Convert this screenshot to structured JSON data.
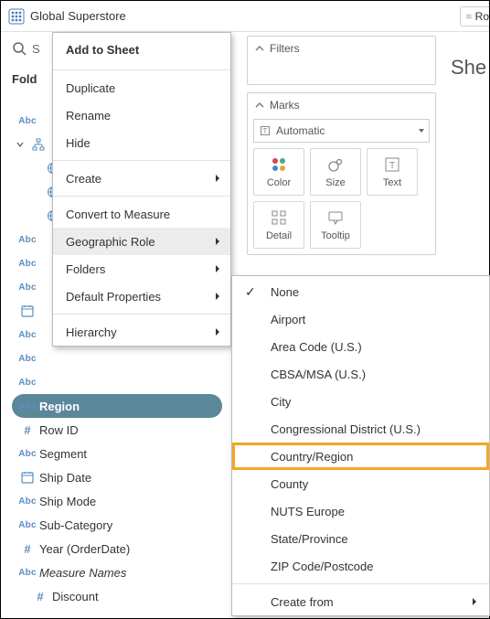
{
  "header": {
    "title": "Global Superstore"
  },
  "search": {
    "placeholder": "S"
  },
  "folders_label": "Fold",
  "sheet_stub": "She",
  "rows_stub": "Ro",
  "filters_card": "Filters",
  "marks_card": "Marks",
  "marks_select": "Automatic",
  "marks_buttons": {
    "color": "Color",
    "size": "Size",
    "text": "Text",
    "detail": "Detail",
    "tooltip": "Tooltip"
  },
  "fields": [
    {
      "icon": "abc",
      "label": "",
      "indent": 0,
      "kind": "abc"
    },
    {
      "icon": "hier",
      "label": "",
      "indent": 0,
      "expanded": true
    },
    {
      "icon": "globe",
      "label": "",
      "indent": 2
    },
    {
      "icon": "globe",
      "label": "",
      "indent": 2
    },
    {
      "icon": "globe",
      "label": "",
      "indent": 2
    },
    {
      "icon": "abc",
      "label": "",
      "indent": 0
    },
    {
      "icon": "abc",
      "label": "",
      "indent": 0
    },
    {
      "icon": "abc",
      "label": "",
      "indent": 0
    },
    {
      "icon": "date",
      "label": "",
      "indent": 0
    },
    {
      "icon": "abc",
      "label": "",
      "indent": 0
    },
    {
      "icon": "abc",
      "label": "",
      "indent": 0
    },
    {
      "icon": "abc",
      "label": "",
      "indent": 0
    },
    {
      "icon": "abc",
      "label": "Region",
      "indent": 0,
      "selected": true
    },
    {
      "icon": "hash",
      "label": "Row ID",
      "indent": 0
    },
    {
      "icon": "abc",
      "label": "Segment",
      "indent": 0
    },
    {
      "icon": "date",
      "label": "Ship Date",
      "indent": 0
    },
    {
      "icon": "abc",
      "label": "Ship Mode",
      "indent": 0
    },
    {
      "icon": "abc",
      "label": "Sub-Category",
      "indent": 0
    },
    {
      "icon": "hash",
      "label": "Year (OrderDate)",
      "indent": 0
    },
    {
      "icon": "abc",
      "label": "Measure Names",
      "indent": 0,
      "italic": true
    },
    {
      "icon": "hash",
      "label": "Discount",
      "indent": 1
    }
  ],
  "context_menu": {
    "header": "Add to Sheet",
    "items": [
      {
        "label": "Duplicate"
      },
      {
        "label": "Rename"
      },
      {
        "label": "Hide"
      },
      {
        "sep": true
      },
      {
        "label": "Create",
        "submenu": true
      },
      {
        "sep": true
      },
      {
        "label": "Convert to Measure"
      },
      {
        "label": "Geographic Role",
        "submenu": true,
        "hover": true
      },
      {
        "label": "Folders",
        "submenu": true
      },
      {
        "label": "Default Properties",
        "submenu": true
      },
      {
        "sep": true
      },
      {
        "label": "Hierarchy",
        "submenu": true
      }
    ]
  },
  "geo_submenu": {
    "items": [
      {
        "label": "None",
        "checked": true
      },
      {
        "label": "Airport"
      },
      {
        "label": "Area Code (U.S.)"
      },
      {
        "label": "CBSA/MSA (U.S.)"
      },
      {
        "label": "City"
      },
      {
        "label": "Congressional District (U.S.)"
      },
      {
        "label": "Country/Region",
        "highlight": true
      },
      {
        "label": "County"
      },
      {
        "label": "NUTS Europe"
      },
      {
        "label": "State/Province"
      },
      {
        "label": "ZIP Code/Postcode"
      },
      {
        "sep": true
      },
      {
        "label": "Create from",
        "submenu": true
      }
    ]
  }
}
